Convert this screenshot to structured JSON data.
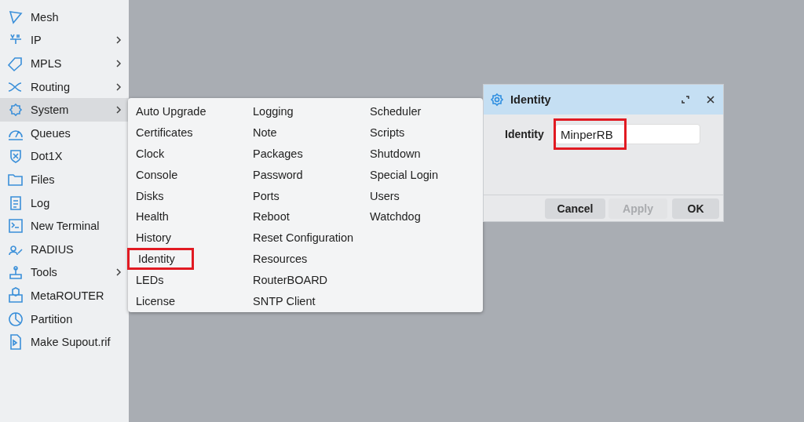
{
  "sidebar": {
    "items": [
      {
        "label": "Mesh",
        "submenu": false,
        "selected": false
      },
      {
        "label": "IP",
        "submenu": true,
        "selected": false
      },
      {
        "label": "MPLS",
        "submenu": true,
        "selected": false
      },
      {
        "label": "Routing",
        "submenu": true,
        "selected": false
      },
      {
        "label": "System",
        "submenu": true,
        "selected": true
      },
      {
        "label": "Queues",
        "submenu": false,
        "selected": false
      },
      {
        "label": "Dot1X",
        "submenu": false,
        "selected": false
      },
      {
        "label": "Files",
        "submenu": false,
        "selected": false
      },
      {
        "label": "Log",
        "submenu": false,
        "selected": false
      },
      {
        "label": "New Terminal",
        "submenu": false,
        "selected": false
      },
      {
        "label": "RADIUS",
        "submenu": false,
        "selected": false
      },
      {
        "label": "Tools",
        "submenu": true,
        "selected": false
      },
      {
        "label": "MetaROUTER",
        "submenu": false,
        "selected": false
      },
      {
        "label": "Partition",
        "submenu": false,
        "selected": false
      },
      {
        "label": "Make Supout.rif",
        "submenu": false,
        "selected": false
      }
    ]
  },
  "system_menu": {
    "items": [
      {
        "label": "Auto Upgrade",
        "highlighted": false
      },
      {
        "label": "Certificates",
        "highlighted": false
      },
      {
        "label": "Clock",
        "highlighted": false
      },
      {
        "label": "Console",
        "highlighted": false
      },
      {
        "label": "Disks",
        "highlighted": false
      },
      {
        "label": "Health",
        "highlighted": false
      },
      {
        "label": "History",
        "highlighted": false
      },
      {
        "label": "Identity",
        "highlighted": true
      },
      {
        "label": "LEDs",
        "highlighted": false
      },
      {
        "label": "License",
        "highlighted": false
      },
      {
        "label": "Logging",
        "highlighted": false
      },
      {
        "label": "Note",
        "highlighted": false
      },
      {
        "label": "Packages",
        "highlighted": false
      },
      {
        "label": "Password",
        "highlighted": false
      },
      {
        "label": "Ports",
        "highlighted": false
      },
      {
        "label": "Reboot",
        "highlighted": false
      },
      {
        "label": "Reset Configuration",
        "highlighted": false
      },
      {
        "label": "Resources",
        "highlighted": false
      },
      {
        "label": "RouterBOARD",
        "highlighted": false
      },
      {
        "label": "SNTP Client",
        "highlighted": false
      },
      {
        "label": "Scheduler",
        "highlighted": false
      },
      {
        "label": "Scripts",
        "highlighted": false
      },
      {
        "label": "Shutdown",
        "highlighted": false
      },
      {
        "label": "Special Login",
        "highlighted": false
      },
      {
        "label": "Users",
        "highlighted": false
      },
      {
        "label": "Watchdog",
        "highlighted": false
      }
    ]
  },
  "dialog": {
    "title": "Identity",
    "field": {
      "label": "Identity",
      "value": "MinperRB",
      "highlighted": true
    },
    "buttons": [
      {
        "label": "Cancel",
        "disabled": false
      },
      {
        "label": "Apply",
        "disabled": true
      },
      {
        "label": "OK",
        "disabled": false
      }
    ]
  }
}
